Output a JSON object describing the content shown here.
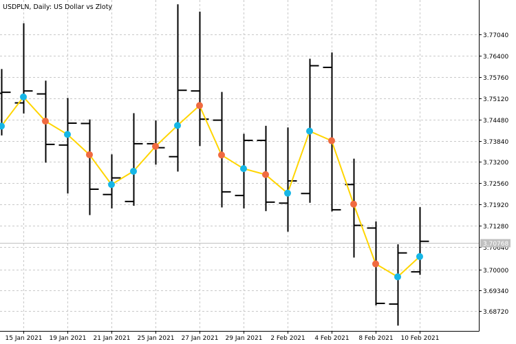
{
  "chart_data": {
    "type": "bar",
    "style": "ohlc",
    "title": "USDPLN, Daily:  US Dollar vs Zloty",
    "ylim": [
      3.6811,
      3.7808
    ],
    "grid": true,
    "y_ticks": [
      3.6872,
      3.6934,
      3.6996,
      3.7064,
      3.7128,
      3.7192,
      3.7256,
      3.732,
      3.7384,
      3.7448,
      3.7512,
      3.7576,
      3.764,
      3.7704
    ],
    "y_tick_labels": [
      "3.68720",
      "3.69340",
      "3.70000",
      "3.70640",
      "3.71280",
      "3.71920",
      "3.72560",
      "3.73200",
      "3.73840",
      "3.74480",
      "3.75120",
      "3.75760",
      "3.76400",
      "3.77040"
    ],
    "x_tick_labels": [
      "15 Jan 2021",
      "19 Jan 2021",
      "21 Jan 2021",
      "25 Jan 2021",
      "27 Jan 2021",
      "29 Jan 2021",
      "2 Feb 2021",
      "4 Feb 2021",
      "8 Feb 2021",
      "10 Feb 2021"
    ],
    "current_price": {
      "value": 3.7076,
      "label": "3.70768"
    },
    "bars": [
      {
        "date": "14 Jan 2021",
        "open": 3.7527,
        "high": 3.76,
        "low": 3.74,
        "close": 3.753
      },
      {
        "date": "15 Jan 2021",
        "open": 3.7498,
        "high": 3.7738,
        "low": 3.7466,
        "close": 3.7534
      },
      {
        "date": "18 Jan 2021",
        "open": 3.7525,
        "high": 3.7565,
        "low": 3.7318,
        "close": 3.7373
      },
      {
        "date": "19 Jan 2021",
        "open": 3.7371,
        "high": 3.7513,
        "low": 3.7225,
        "close": 3.7437
      },
      {
        "date": "20 Jan 2021",
        "open": 3.7436,
        "high": 3.7448,
        "low": 3.716,
        "close": 3.7238
      },
      {
        "date": "21 Jan 2021",
        "open": 3.7222,
        "high": 3.7343,
        "low": 3.718,
        "close": 3.7272
      },
      {
        "date": "22 Jan 2021",
        "open": 3.7201,
        "high": 3.7467,
        "low": 3.7188,
        "close": 3.7375
      },
      {
        "date": "25 Jan 2021",
        "open": 3.7375,
        "high": 3.7445,
        "low": 3.7312,
        "close": 3.7363
      },
      {
        "date": "26 Jan 2021",
        "open": 3.7336,
        "high": 3.7795,
        "low": 3.7291,
        "close": 3.7536
      },
      {
        "date": "27 Jan 2021",
        "open": 3.7534,
        "high": 3.7773,
        "low": 3.7368,
        "close": 3.7449
      },
      {
        "date": "28 Jan 2021",
        "open": 3.7446,
        "high": 3.7531,
        "low": 3.7183,
        "close": 3.723
      },
      {
        "date": "29 Jan 2021",
        "open": 3.7219,
        "high": 3.7405,
        "low": 3.718,
        "close": 3.7385
      },
      {
        "date": "1 Feb 2021",
        "open": 3.7385,
        "high": 3.7429,
        "low": 3.7172,
        "close": 3.7199
      },
      {
        "date": "2 Feb 2021",
        "open": 3.7196,
        "high": 3.7424,
        "low": 3.711,
        "close": 3.7263
      },
      {
        "date": "3 Feb 2021",
        "open": 3.7225,
        "high": 3.7631,
        "low": 3.7197,
        "close": 3.761
      },
      {
        "date": "4 Feb 2021",
        "open": 3.7605,
        "high": 3.765,
        "low": 3.7171,
        "close": 3.7176
      },
      {
        "date": "5 Feb 2021",
        "open": 3.7252,
        "high": 3.733,
        "low": 3.7032,
        "close": 3.7129
      },
      {
        "date": "8 Feb 2021",
        "open": 3.7121,
        "high": 3.7141,
        "low": 3.6888,
        "close": 3.6894
      },
      {
        "date": "9 Feb 2021",
        "open": 3.6892,
        "high": 3.7072,
        "low": 3.6827,
        "close": 3.7046
      },
      {
        "date": "10 Feb 2021",
        "open": 3.6989,
        "high": 3.7184,
        "low": 3.698,
        "close": 3.7081
      }
    ],
    "zigzag": [
      {
        "bar": 0,
        "value": 3.7428,
        "dot": "cyan"
      },
      {
        "bar": 1,
        "value": 3.7516,
        "dot": "cyan"
      },
      {
        "bar": 2,
        "value": 3.7443,
        "dot": "red"
      },
      {
        "bar": 3,
        "value": 3.7403,
        "dot": "cyan"
      },
      {
        "bar": 4,
        "value": 3.7342,
        "dot": "red"
      },
      {
        "bar": 5,
        "value": 3.7252,
        "dot": "cyan"
      },
      {
        "bar": 6,
        "value": 3.7292,
        "dot": "cyan"
      },
      {
        "bar": 7,
        "value": 3.7367,
        "dot": "red"
      },
      {
        "bar": 8,
        "value": 3.743,
        "dot": "cyan"
      },
      {
        "bar": 9,
        "value": 3.749,
        "dot": "red"
      },
      {
        "bar": 10,
        "value": 3.7341,
        "dot": "red"
      },
      {
        "bar": 11,
        "value": 3.73,
        "dot": "cyan"
      },
      {
        "bar": 12,
        "value": 3.7282,
        "dot": "red"
      },
      {
        "bar": 13,
        "value": 3.7226,
        "dot": "cyan"
      },
      {
        "bar": 14,
        "value": 3.7413,
        "dot": "cyan"
      },
      {
        "bar": 15,
        "value": 3.7384,
        "dot": "red"
      },
      {
        "bar": 16,
        "value": 3.7193,
        "dot": "red"
      },
      {
        "bar": 17,
        "value": 3.7013,
        "dot": "red"
      },
      {
        "bar": 18,
        "value": 3.6974,
        "dot": "cyan"
      },
      {
        "bar": 19,
        "value": 3.7035,
        "dot": "cyan"
      }
    ],
    "colors": {
      "background": "#ffffff",
      "grid": "#c8c8c8",
      "bars": "#000000",
      "axis": "#000000",
      "zigzag_line": "#ffd500",
      "dot_cyan": "#16b6e6",
      "dot_red": "#f06a40",
      "price_line": "#c0c0c0",
      "price_label_bg": "#c0c0c0",
      "price_label_text": "#ffffff"
    }
  }
}
